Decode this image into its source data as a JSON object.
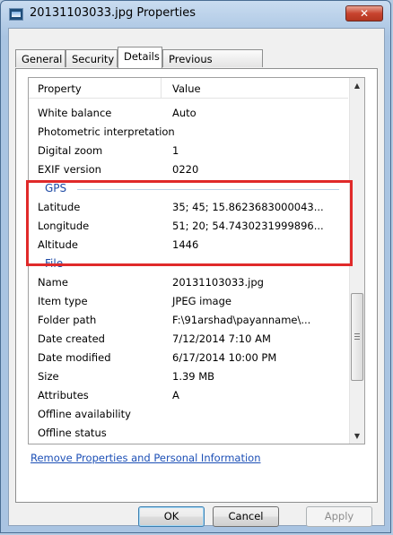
{
  "window": {
    "title": "20131103033.jpg Properties",
    "close_label": "✕"
  },
  "tabs": [
    {
      "label": "General"
    },
    {
      "label": "Security"
    },
    {
      "label": "Details"
    },
    {
      "label": "Previous Versions"
    }
  ],
  "list": {
    "header_property": "Property",
    "header_value": "Value",
    "rows_top": [
      {
        "p": "White balance",
        "v": "Auto"
      },
      {
        "p": "Photometric interpretation",
        "v": ""
      },
      {
        "p": "Digital zoom",
        "v": "1"
      },
      {
        "p": "EXIF version",
        "v": "0220"
      }
    ],
    "group_gps": "GPS",
    "rows_gps": [
      {
        "p": "Latitude",
        "v": "35; 45; 15.8623683000043..."
      },
      {
        "p": "Longitude",
        "v": "51; 20; 54.7430231999896..."
      },
      {
        "p": "Altitude",
        "v": "1446"
      }
    ],
    "group_file": "File",
    "rows_file": [
      {
        "p": "Name",
        "v": "20131103033.jpg"
      },
      {
        "p": "Item type",
        "v": "JPEG image"
      },
      {
        "p": "Folder path",
        "v": "F:\\91arshad\\payanname\\..."
      },
      {
        "p": "Date created",
        "v": "7/12/2014 7:10 AM"
      },
      {
        "p": "Date modified",
        "v": "6/17/2014 10:00 PM"
      },
      {
        "p": "Size",
        "v": "1.39 MB"
      },
      {
        "p": "Attributes",
        "v": "A"
      },
      {
        "p": "Offline availability",
        "v": ""
      },
      {
        "p": "Offline status",
        "v": ""
      }
    ]
  },
  "remove_link": "Remove Properties and Personal Information",
  "buttons": {
    "ok": "OK",
    "cancel": "Cancel",
    "apply": "Apply"
  },
  "colors": {
    "highlight": "#e02a2a",
    "group_label": "#1e4aa5",
    "link": "#1c4fb6"
  }
}
